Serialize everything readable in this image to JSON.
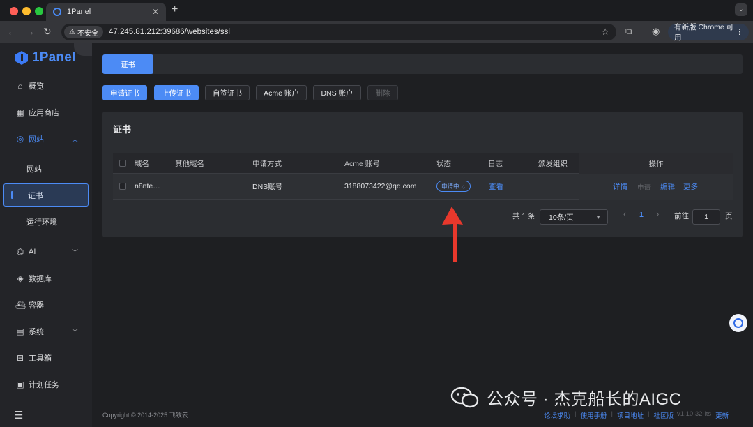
{
  "browser": {
    "tab_title": "1Panel",
    "tab_close": "✕",
    "new_tab": "+",
    "insecure_label": "不安全",
    "url": "47.245.81.212:39686/websites/ssl",
    "update_label": "有新版 Chrome 可用",
    "update_dots": "⋮"
  },
  "sidebar": {
    "logo_text": "1Panel",
    "items": [
      {
        "label": "概览",
        "icon": "home-icon"
      },
      {
        "label": "应用商店",
        "icon": "grid-icon"
      },
      {
        "label": "网站",
        "icon": "globe-icon"
      },
      {
        "label": "AI",
        "icon": "robot-icon"
      },
      {
        "label": "数据库",
        "icon": "database-icon"
      },
      {
        "label": "容器",
        "icon": "container-icon"
      },
      {
        "label": "系统",
        "icon": "system-icon"
      },
      {
        "label": "工具箱",
        "icon": "toolbox-icon"
      },
      {
        "label": "计划任务",
        "icon": "calendar-icon"
      }
    ],
    "website_sub": [
      "网站",
      "证书",
      "运行环境"
    ]
  },
  "main": {
    "tab_label": "证书",
    "buttons": {
      "apply": "申请证书",
      "upload": "上传证书",
      "self_signed": "自签证书",
      "acme": "Acme 账户",
      "dns": "DNS 账户",
      "delete": "删除"
    },
    "panel_title": "证书",
    "table": {
      "headers": [
        "域名",
        "其他域名",
        "申请方式",
        "Acme 账号",
        "状态",
        "日志",
        "颁发组织",
        "操作"
      ],
      "rows": [
        {
          "domain": "n8nte…",
          "other_domains": "",
          "method": "DNS账号",
          "acme": "3188073422@qq.com",
          "status": "申请中",
          "log": "查看",
          "issuer": "",
          "ops": [
            "详情",
            "申请",
            "编辑",
            "更多"
          ]
        }
      ]
    },
    "pagination": {
      "total": "共 1 条",
      "page_size": "10条/页",
      "prev": "‹",
      "current": "1",
      "next": "›",
      "goto_label": "前往",
      "goto_value": "1",
      "page_suffix": "页"
    },
    "footer": {
      "copyright": "Copyright © 2014-2025 飞致云",
      "links": [
        "论坛求助",
        "使用手册",
        "项目地址",
        "社区版"
      ],
      "version": "v1.10.32-lts",
      "update": "更新"
    }
  },
  "watermark": "公众号 · 杰克船长的AIGC",
  "colors": {
    "accent": "#4c8bf5",
    "arrow": "#e8382c",
    "sidebar_bg": "#232428",
    "panel_bg": "#2b2d31"
  }
}
